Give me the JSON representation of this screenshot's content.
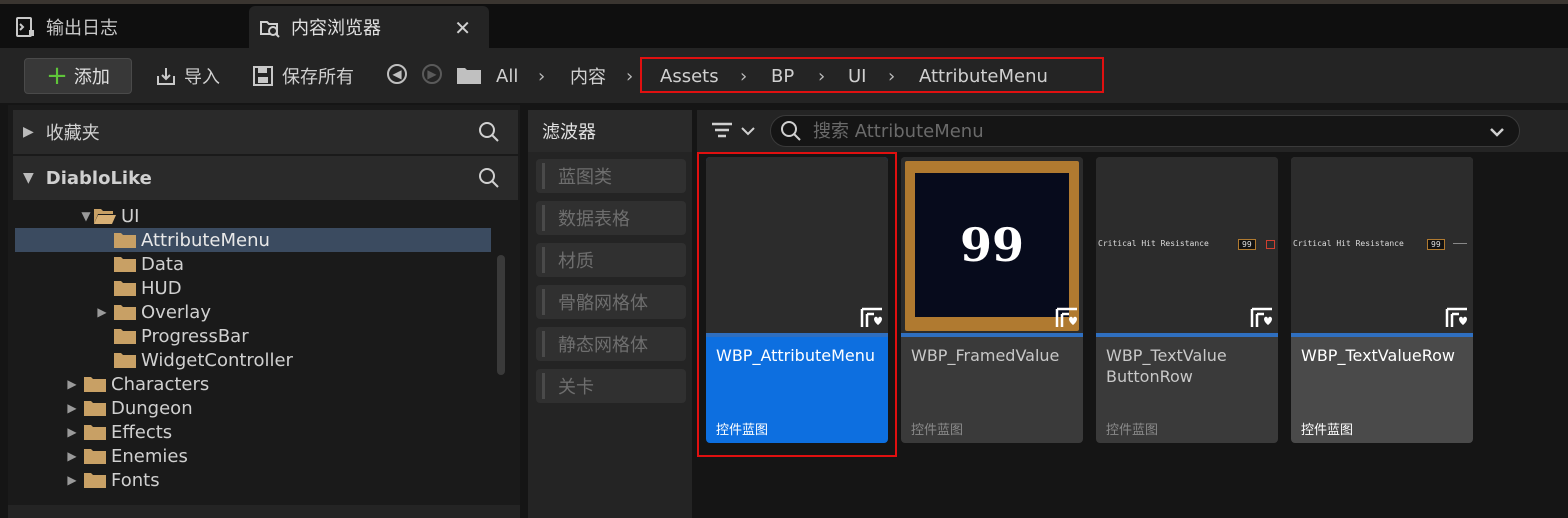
{
  "tabs": [
    {
      "label": "输出日志",
      "icon": "output-log-icon"
    },
    {
      "label": "内容浏览器",
      "icon": "content-browser-icon",
      "active": true
    }
  ],
  "toolbar": {
    "add_label": "添加",
    "import_label": "导入",
    "save_all_label": "保存所有"
  },
  "breadcrumb": [
    "All",
    "内容",
    "Assets",
    "BP",
    "UI",
    "AttributeMenu"
  ],
  "sidebar": {
    "favorites_label": "收藏夹",
    "project_label": "DiabloLike",
    "tree": [
      {
        "label": "UI",
        "expanded": true
      },
      {
        "label": "AttributeMenu",
        "selected": true
      },
      {
        "label": "Data"
      },
      {
        "label": "HUD"
      },
      {
        "label": "Overlay"
      },
      {
        "label": "ProgressBar"
      },
      {
        "label": "WidgetController"
      },
      {
        "label": "Characters"
      },
      {
        "label": "Dungeon"
      },
      {
        "label": "Effects"
      },
      {
        "label": "Enemies"
      },
      {
        "label": "Fonts"
      }
    ]
  },
  "filters": {
    "title": "滤波器",
    "items": [
      "蓝图类",
      "数据表格",
      "材质",
      "骨骼网格体",
      "静态网格体",
      "关卡"
    ]
  },
  "search": {
    "placeholder": "搜索 AttributeMenu"
  },
  "assets": [
    {
      "name": "WBP_AttributeMenu",
      "type": "控件蓝图",
      "selected": true
    },
    {
      "name": "WBP_FramedValue",
      "type": "控件蓝图",
      "thumbnail_text": "99"
    },
    {
      "name": "WBP_TextValue ButtonRow",
      "type": "控件蓝图",
      "preview_label": "Critical Hit Resistance",
      "preview_value": "99"
    },
    {
      "name": "WBP_TextValueRow",
      "type": "控件蓝图",
      "preview_label": "Critical Hit Resistance",
      "preview_value": "99"
    }
  ],
  "colors": {
    "selection_blue": "#0d6fe0",
    "highlight_red": "#e01010",
    "add_green": "#5fc43a",
    "folder_tan": "#c8a065"
  }
}
